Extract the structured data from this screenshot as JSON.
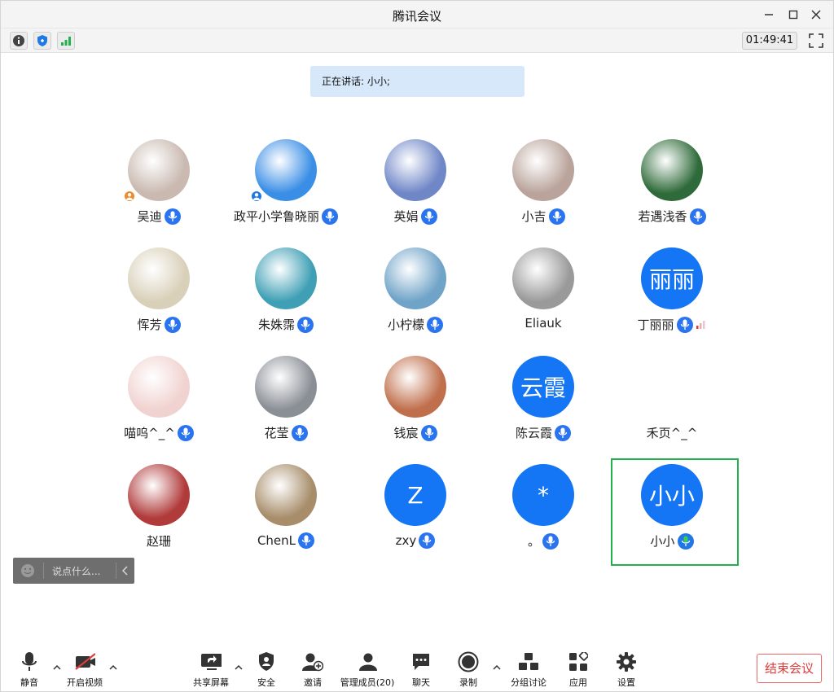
{
  "window": {
    "title": "腾讯会议"
  },
  "status": {
    "timer": "01:49:41"
  },
  "speaking": {
    "text": "正在讲话: 小小;"
  },
  "chat": {
    "placeholder": "说点什么..."
  },
  "participants": [
    {
      "name": "吴迪",
      "avatar_color": "#c9b9b0",
      "host": true,
      "mic": "blue"
    },
    {
      "name": "政平小学鲁晓丽",
      "avatar_color": "#3a8ee6",
      "host": true,
      "mic": "blue"
    },
    {
      "name": "英娟",
      "avatar_color": "#6f86c7",
      "host": false,
      "mic": "blue"
    },
    {
      "name": "小吉",
      "avatar_color": "#b9a39a",
      "host": false,
      "mic": "blue"
    },
    {
      "name": "若遇浅香",
      "avatar_color": "#2f6b3a",
      "host": false,
      "mic": "blue"
    },
    {
      "name": "恽芳",
      "avatar_color": "#d9d0b9",
      "host": false,
      "mic": "blue"
    },
    {
      "name": "朱姝霈",
      "avatar_color": "#3e9fb5",
      "host": false,
      "mic": "blue"
    },
    {
      "name": "小柠檬",
      "avatar_color": "#6fa3c8",
      "host": false,
      "mic": "blue"
    },
    {
      "name": "Eliauk",
      "avatar_color": "#9a9a9a",
      "host": false,
      "mic": "none"
    },
    {
      "name": "丁丽丽",
      "avatar_text": "丽丽",
      "avatar_color": "#1475f5",
      "host": false,
      "mic": "blue",
      "signal": true
    },
    {
      "name": "喵呜^_^",
      "avatar_color": "#f0d3d0",
      "host": false,
      "mic": "blue"
    },
    {
      "name": "花莹",
      "avatar_color": "#8a8f96",
      "host": false,
      "mic": "blue"
    },
    {
      "name": "钱宸",
      "avatar_color": "#c06f4c",
      "host": false,
      "mic": "blue"
    },
    {
      "name": "陈云霞",
      "avatar_text": "云霞",
      "avatar_color": "#1475f5",
      "host": false,
      "mic": "blue"
    },
    {
      "name": "禾页^_^",
      "avatar_color": "#ffffff",
      "host": false,
      "mic": "none"
    },
    {
      "name": "赵珊",
      "avatar_color": "#b13a3a",
      "host": false,
      "mic": "none"
    },
    {
      "name": "ChenL",
      "avatar_color": "#a78d6a",
      "host": false,
      "mic": "blue"
    },
    {
      "name": "zxy",
      "avatar_text": "Z",
      "avatar_color": "#1475f5",
      "host": false,
      "mic": "blue"
    },
    {
      "name": "。",
      "avatar_text": "*",
      "avatar_color": "#1475f5",
      "host": false,
      "mic": "blue"
    },
    {
      "name": "小小",
      "avatar_text": "小小",
      "avatar_color": "#1475f5",
      "host": false,
      "mic": "green"
    }
  ],
  "toolbar": {
    "mute": "静音",
    "video": "开启视频",
    "share": "共享屏幕",
    "security": "安全",
    "invite": "邀请",
    "members": "管理成员(20)",
    "chat": "聊天",
    "record": "录制",
    "breakout": "分组讨论",
    "apps": "应用",
    "settings": "设置"
  },
  "end_button": "结束会议"
}
